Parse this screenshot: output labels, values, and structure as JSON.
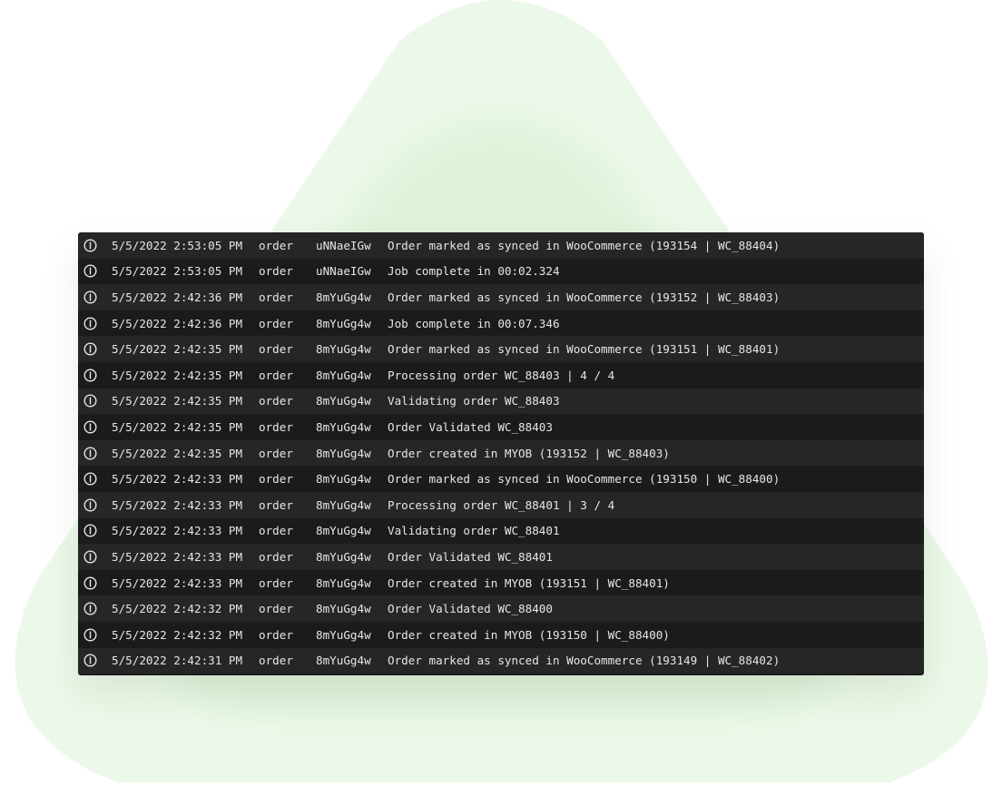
{
  "colors": {
    "background": "#ffffff",
    "panel": "#1c1c1c",
    "row_alt": "#262626",
    "text": "#e6e6e6",
    "accent_green": "#e6f6e2"
  },
  "log": {
    "entries": [
      {
        "icon": "info-icon",
        "time": "5/5/2022 2:53:05 PM",
        "type": "order",
        "job": "uNNaeIGw",
        "message": "Order marked as synced in WooCommerce (193154 | WC_88404)"
      },
      {
        "icon": "info-icon",
        "time": "5/5/2022 2:53:05 PM",
        "type": "order",
        "job": "uNNaeIGw",
        "message": "Job complete in 00:02.324"
      },
      {
        "icon": "info-icon",
        "time": "5/5/2022 2:42:36 PM",
        "type": "order",
        "job": "8mYuGg4w",
        "message": "Order marked as synced in WooCommerce (193152 | WC_88403)"
      },
      {
        "icon": "info-icon",
        "time": "5/5/2022 2:42:36 PM",
        "type": "order",
        "job": "8mYuGg4w",
        "message": "Job complete in 00:07.346"
      },
      {
        "icon": "info-icon",
        "time": "5/5/2022 2:42:35 PM",
        "type": "order",
        "job": "8mYuGg4w",
        "message": "Order marked as synced in WooCommerce (193151 | WC_88401)"
      },
      {
        "icon": "info-icon",
        "time": "5/5/2022 2:42:35 PM",
        "type": "order",
        "job": "8mYuGg4w",
        "message": "Processing order WC_88403 | 4 / 4"
      },
      {
        "icon": "info-icon",
        "time": "5/5/2022 2:42:35 PM",
        "type": "order",
        "job": "8mYuGg4w",
        "message": "Validating order WC_88403"
      },
      {
        "icon": "info-icon",
        "time": "5/5/2022 2:42:35 PM",
        "type": "order",
        "job": "8mYuGg4w",
        "message": "Order Validated WC_88403"
      },
      {
        "icon": "info-icon",
        "time": "5/5/2022 2:42:35 PM",
        "type": "order",
        "job": "8mYuGg4w",
        "message": "Order created in MYOB (193152 | WC_88403)"
      },
      {
        "icon": "info-icon",
        "time": "5/5/2022 2:42:33 PM",
        "type": "order",
        "job": "8mYuGg4w",
        "message": "Order marked as synced in WooCommerce (193150 | WC_88400)"
      },
      {
        "icon": "info-icon",
        "time": "5/5/2022 2:42:33 PM",
        "type": "order",
        "job": "8mYuGg4w",
        "message": "Processing order WC_88401 | 3 / 4"
      },
      {
        "icon": "info-icon",
        "time": "5/5/2022 2:42:33 PM",
        "type": "order",
        "job": "8mYuGg4w",
        "message": "Validating order WC_88401"
      },
      {
        "icon": "info-icon",
        "time": "5/5/2022 2:42:33 PM",
        "type": "order",
        "job": "8mYuGg4w",
        "message": "Order Validated WC_88401"
      },
      {
        "icon": "info-icon",
        "time": "5/5/2022 2:42:33 PM",
        "type": "order",
        "job": "8mYuGg4w",
        "message": "Order created in MYOB (193151 | WC_88401)"
      },
      {
        "icon": "info-icon",
        "time": "5/5/2022 2:42:32 PM",
        "type": "order",
        "job": "8mYuGg4w",
        "message": "Order Validated WC_88400"
      },
      {
        "icon": "info-icon",
        "time": "5/5/2022 2:42:32 PM",
        "type": "order",
        "job": "8mYuGg4w",
        "message": "Order created in MYOB (193150 | WC_88400)"
      },
      {
        "icon": "info-icon",
        "time": "5/5/2022 2:42:31 PM",
        "type": "order",
        "job": "8mYuGg4w",
        "message": "Order marked as synced in WooCommerce (193149 | WC_88402)"
      }
    ]
  }
}
